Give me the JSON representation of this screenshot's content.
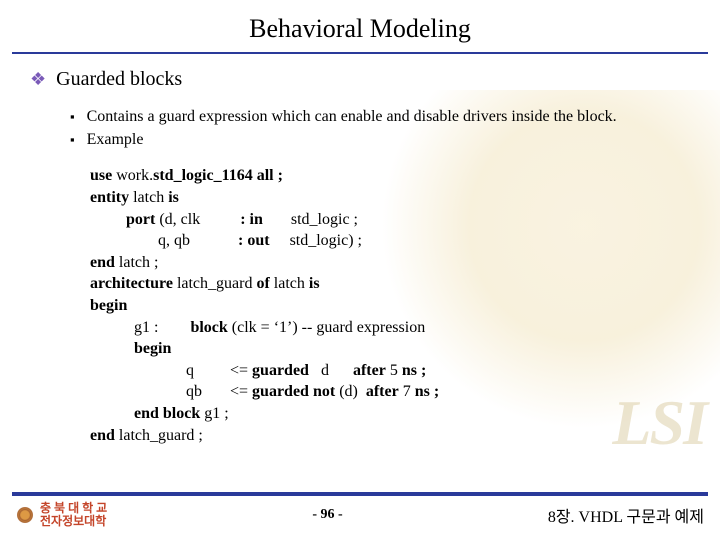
{
  "title": "Behavioral Modeling",
  "section": "Guarded blocks",
  "bullets": [
    "Contains a guard expression which can enable and disable drivers inside the block.",
    "Example"
  ],
  "code": {
    "l1a": "use",
    "l1b": "work.",
    "l1c": "std_logic_1164",
    "l1d": "all ;",
    "l2a": "entity",
    "l2b": "latch",
    "l2c": "is",
    "l3a": "port",
    "l3b": "(d, clk",
    "l3c": ": in",
    "l3d": "std_logic ;",
    "l4a": "q, qb",
    "l4b": ": out",
    "l4c": "std_logic) ;",
    "l5a": "end",
    "l5b": "latch ;",
    "l6a": "architecture",
    "l6b": "latch_guard",
    "l6c": "of",
    "l6d": "latch",
    "l6e": "is",
    "l7": "begin",
    "l8a": "g1 :",
    "l8b": "block",
    "l8c": "(clk = ‘1’) -- guard expression",
    "l9": "begin",
    "l10a": "q",
    "l10b": "<=",
    "l10c": "guarded",
    "l10d": "d",
    "l10e": "after",
    "l10f": "5",
    "l10g": "ns ;",
    "l11a": "qb",
    "l11b": "<=",
    "l11c": "guarded",
    "l11d": "not",
    "l11e": "(d)",
    "l11f": "after",
    "l11g": "7",
    "l11h": "ns ;",
    "l12a": "end block",
    "l12b": "g1 ;",
    "l13a": "end",
    "l13b": "latch_guard ;"
  },
  "footer": {
    "uni1": "충 북 대 학 교",
    "uni2": "전자정보대학",
    "pager": "-  96  -",
    "chapter": "8장. VHDL 구문과 예제"
  },
  "watermark": "LSI"
}
